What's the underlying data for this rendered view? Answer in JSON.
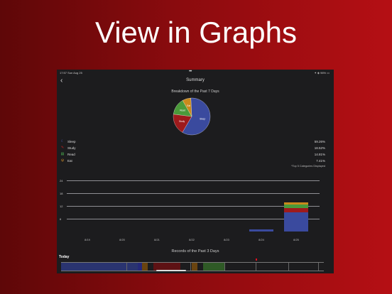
{
  "headline": "View in Graphs",
  "status_bar": {
    "time": "17:57",
    "date": "Sun Aug 25",
    "dots": "•••",
    "battery": "✦ ◈ 96% ▭"
  },
  "nav": {
    "back_symbol": "‹",
    "title": "Summary"
  },
  "pie": {
    "title": "Breakdown of the Past 7 Days",
    "slices": [
      {
        "label": "Sleep",
        "percent": 59.26,
        "color": "#3a4a9e"
      },
      {
        "label": "Study",
        "percent": 18.52,
        "color": "#9e1a1c"
      },
      {
        "label": "Read",
        "percent": 14.81,
        "color": "#4a9a3a"
      },
      {
        "label": "Eat",
        "percent": 7.41,
        "color": "#c98a1c"
      }
    ]
  },
  "legend": [
    {
      "label": "Sleep",
      "value": "59.26%",
      "icon": "moon-icon",
      "glyph": "☾",
      "color": "#5a6adf"
    },
    {
      "label": "Study",
      "value": "18.52%",
      "icon": "pencil-icon",
      "glyph": "✎",
      "color": "#c0221f"
    },
    {
      "label": "Read",
      "value": "14.81%",
      "icon": "book-icon",
      "glyph": "▤",
      "color": "#4caf50"
    },
    {
      "label": "Eat",
      "value": "7.41%",
      "icon": "fork-knife-icon",
      "glyph": "ψ",
      "color": "#d6932a"
    }
  ],
  "footnote": "*Top 5 Categories Displayed",
  "chart_data": {
    "type": "bar",
    "categories": [
      "8/19",
      "8/20",
      "8/21",
      "8/22",
      "8/23",
      "8/24",
      "8/25"
    ],
    "yticks": [
      "24",
      "18",
      "12",
      "6"
    ],
    "ylim": [
      0,
      24
    ],
    "stacked": true,
    "series": [
      {
        "name": "Sleep",
        "color": "#3a4a9e",
        "values": [
          0,
          0,
          0,
          0,
          0,
          1,
          9
        ]
      },
      {
        "name": "Study",
        "color": "#9e1a1c",
        "values": [
          0,
          0,
          0,
          0,
          0,
          0,
          2
        ]
      },
      {
        "name": "Read",
        "color": "#4a9a3a",
        "values": [
          0,
          0,
          0,
          0,
          0,
          0,
          1.8
        ]
      },
      {
        "name": "Eat",
        "color": "#c98a1c",
        "values": [
          0,
          0,
          0,
          0,
          0,
          0,
          1
        ]
      }
    ]
  },
  "records": {
    "title": "Records of the Past 3 Days",
    "today_label": "Today"
  }
}
